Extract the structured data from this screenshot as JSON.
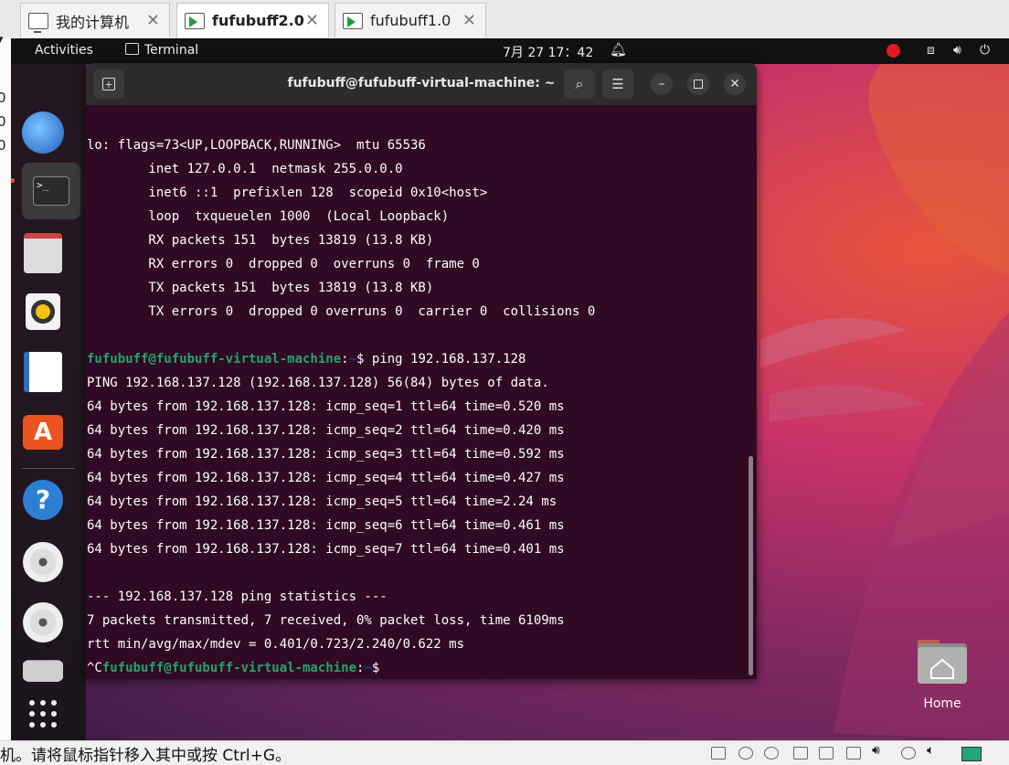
{
  "host_tabs": [
    {
      "label": "我的计算机",
      "active": false,
      "icon": "computer-icon"
    },
    {
      "label": "fufubuff2.0",
      "active": true,
      "icon": "vm-play-icon"
    },
    {
      "label": "fufubuff1.0",
      "active": false,
      "icon": "vm-play-icon"
    }
  ],
  "host_strip_digits": [
    "0",
    "0",
    "0"
  ],
  "topbar": {
    "activities": "Activities",
    "app_name": "Terminal",
    "clock": "7月 27  17：42"
  },
  "terminal": {
    "title": "fufubuff@fufubuff-virtual-machine: ~",
    "lines": [
      {
        "text": "lo: flags=73<UP,LOOPBACK,RUNNING>  mtu 65536"
      },
      {
        "text": "        inet 127.0.0.1  netmask 255.0.0.0"
      },
      {
        "text": "        inet6 ::1  prefixlen 128  scopeid 0x10<host>"
      },
      {
        "text": "        loop  txqueuelen 1000  (Local Loopback)"
      },
      {
        "text": "        RX packets 151  bytes 13819 (13.8 KB)"
      },
      {
        "text": "        RX errors 0  dropped 0  overruns 0  frame 0"
      },
      {
        "text": "        TX packets 151  bytes 13819 (13.8 KB)"
      },
      {
        "text": "        TX errors 0  dropped 0 overruns 0  carrier 0  collisions 0"
      },
      {
        "text": ""
      },
      {
        "prompt_user": "fufubuff@fufubuff-virtual-machine",
        "prompt_path": "~",
        "prompt_sep": ":",
        "command": "$ ping 192.168.137.128"
      },
      {
        "text": "PING 192.168.137.128 (192.168.137.128) 56(84) bytes of data."
      },
      {
        "text": "64 bytes from 192.168.137.128: icmp_seq=1 ttl=64 time=0.520 ms"
      },
      {
        "text": "64 bytes from 192.168.137.128: icmp_seq=2 ttl=64 time=0.420 ms"
      },
      {
        "text": "64 bytes from 192.168.137.128: icmp_seq=3 ttl=64 time=0.592 ms"
      },
      {
        "text": "64 bytes from 192.168.137.128: icmp_seq=4 ttl=64 time=0.427 ms"
      },
      {
        "text": "64 bytes from 192.168.137.128: icmp_seq=5 ttl=64 time=2.24 ms"
      },
      {
        "text": "64 bytes from 192.168.137.128: icmp_seq=6 ttl=64 time=0.461 ms"
      },
      {
        "text": "64 bytes from 192.168.137.128: icmp_seq=7 ttl=64 time=0.401 ms"
      },
      {
        "text": ""
      },
      {
        "text": "--- 192.168.137.128 ping statistics ---"
      },
      {
        "text": "7 packets transmitted, 7 received, 0% packet loss, time 6109ms"
      },
      {
        "text": "rtt min/avg/max/mdev = 0.401/0.723/2.240/0.622 ms"
      },
      {
        "prefix": "^C",
        "prompt_user": "fufubuff@fufubuff-virtual-machine",
        "prompt_path": "~",
        "prompt_sep": ":",
        "command": "$"
      }
    ]
  },
  "dock": [
    "thunderbird-icon",
    "terminal-icon",
    "files-icon",
    "rhythmbox-icon",
    "libreoffice-writer-icon",
    "app-center-icon",
    "help-icon",
    "dvd-icon",
    "dvd-icon",
    "drive-icon",
    "show-apps-icon"
  ],
  "desktop": {
    "home_label": "Home"
  },
  "statusbar": {
    "hint": "机。请将鼠标指针移入其中或按 Ctrl+G。"
  },
  "colors": {
    "terminal_bg": "#300a24",
    "prompt_green": "#26a269",
    "prompt_blue": "#12488b",
    "accent": "#e95420"
  }
}
